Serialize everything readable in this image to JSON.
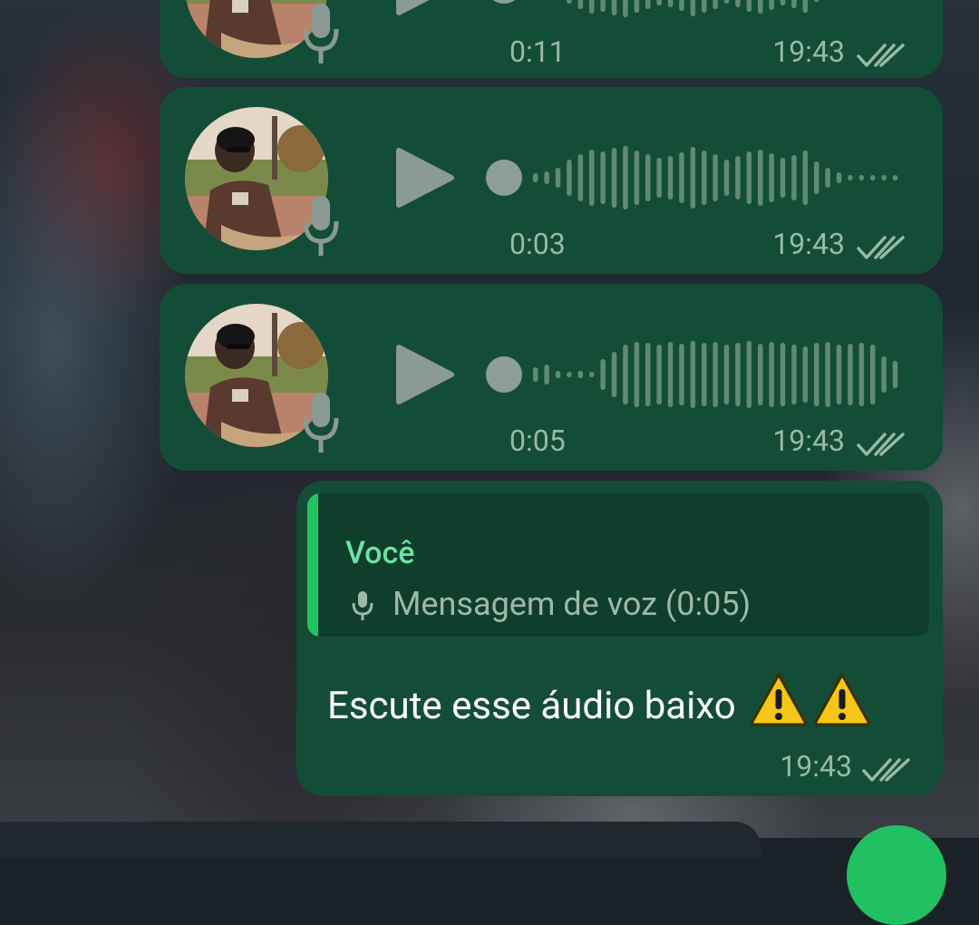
{
  "chat": {
    "voice_messages": [
      {
        "duration": "0:11",
        "time": "19:43",
        "status_icon": "double-check-icon"
      },
      {
        "duration": "0:03",
        "time": "19:43",
        "status_icon": "double-check-icon"
      },
      {
        "duration": "0:05",
        "time": "19:43",
        "status_icon": "double-check-icon"
      }
    ],
    "reply_message": {
      "quoted_author": "Você",
      "quoted_text": "Mensagem de voz (0:05)",
      "text": "Escute esse áudio baixo",
      "emoji": [
        "warning-emoji",
        "warning-emoji"
      ],
      "time": "19:43",
      "status_icon": "double-check-icon"
    }
  },
  "colors": {
    "bubble": "#144d37",
    "quote_background": "#103e2c",
    "quote_accent": "#22c35e",
    "author": "#6fe0a3",
    "meta_text": "#97b9a8",
    "fab": "#21c063"
  }
}
